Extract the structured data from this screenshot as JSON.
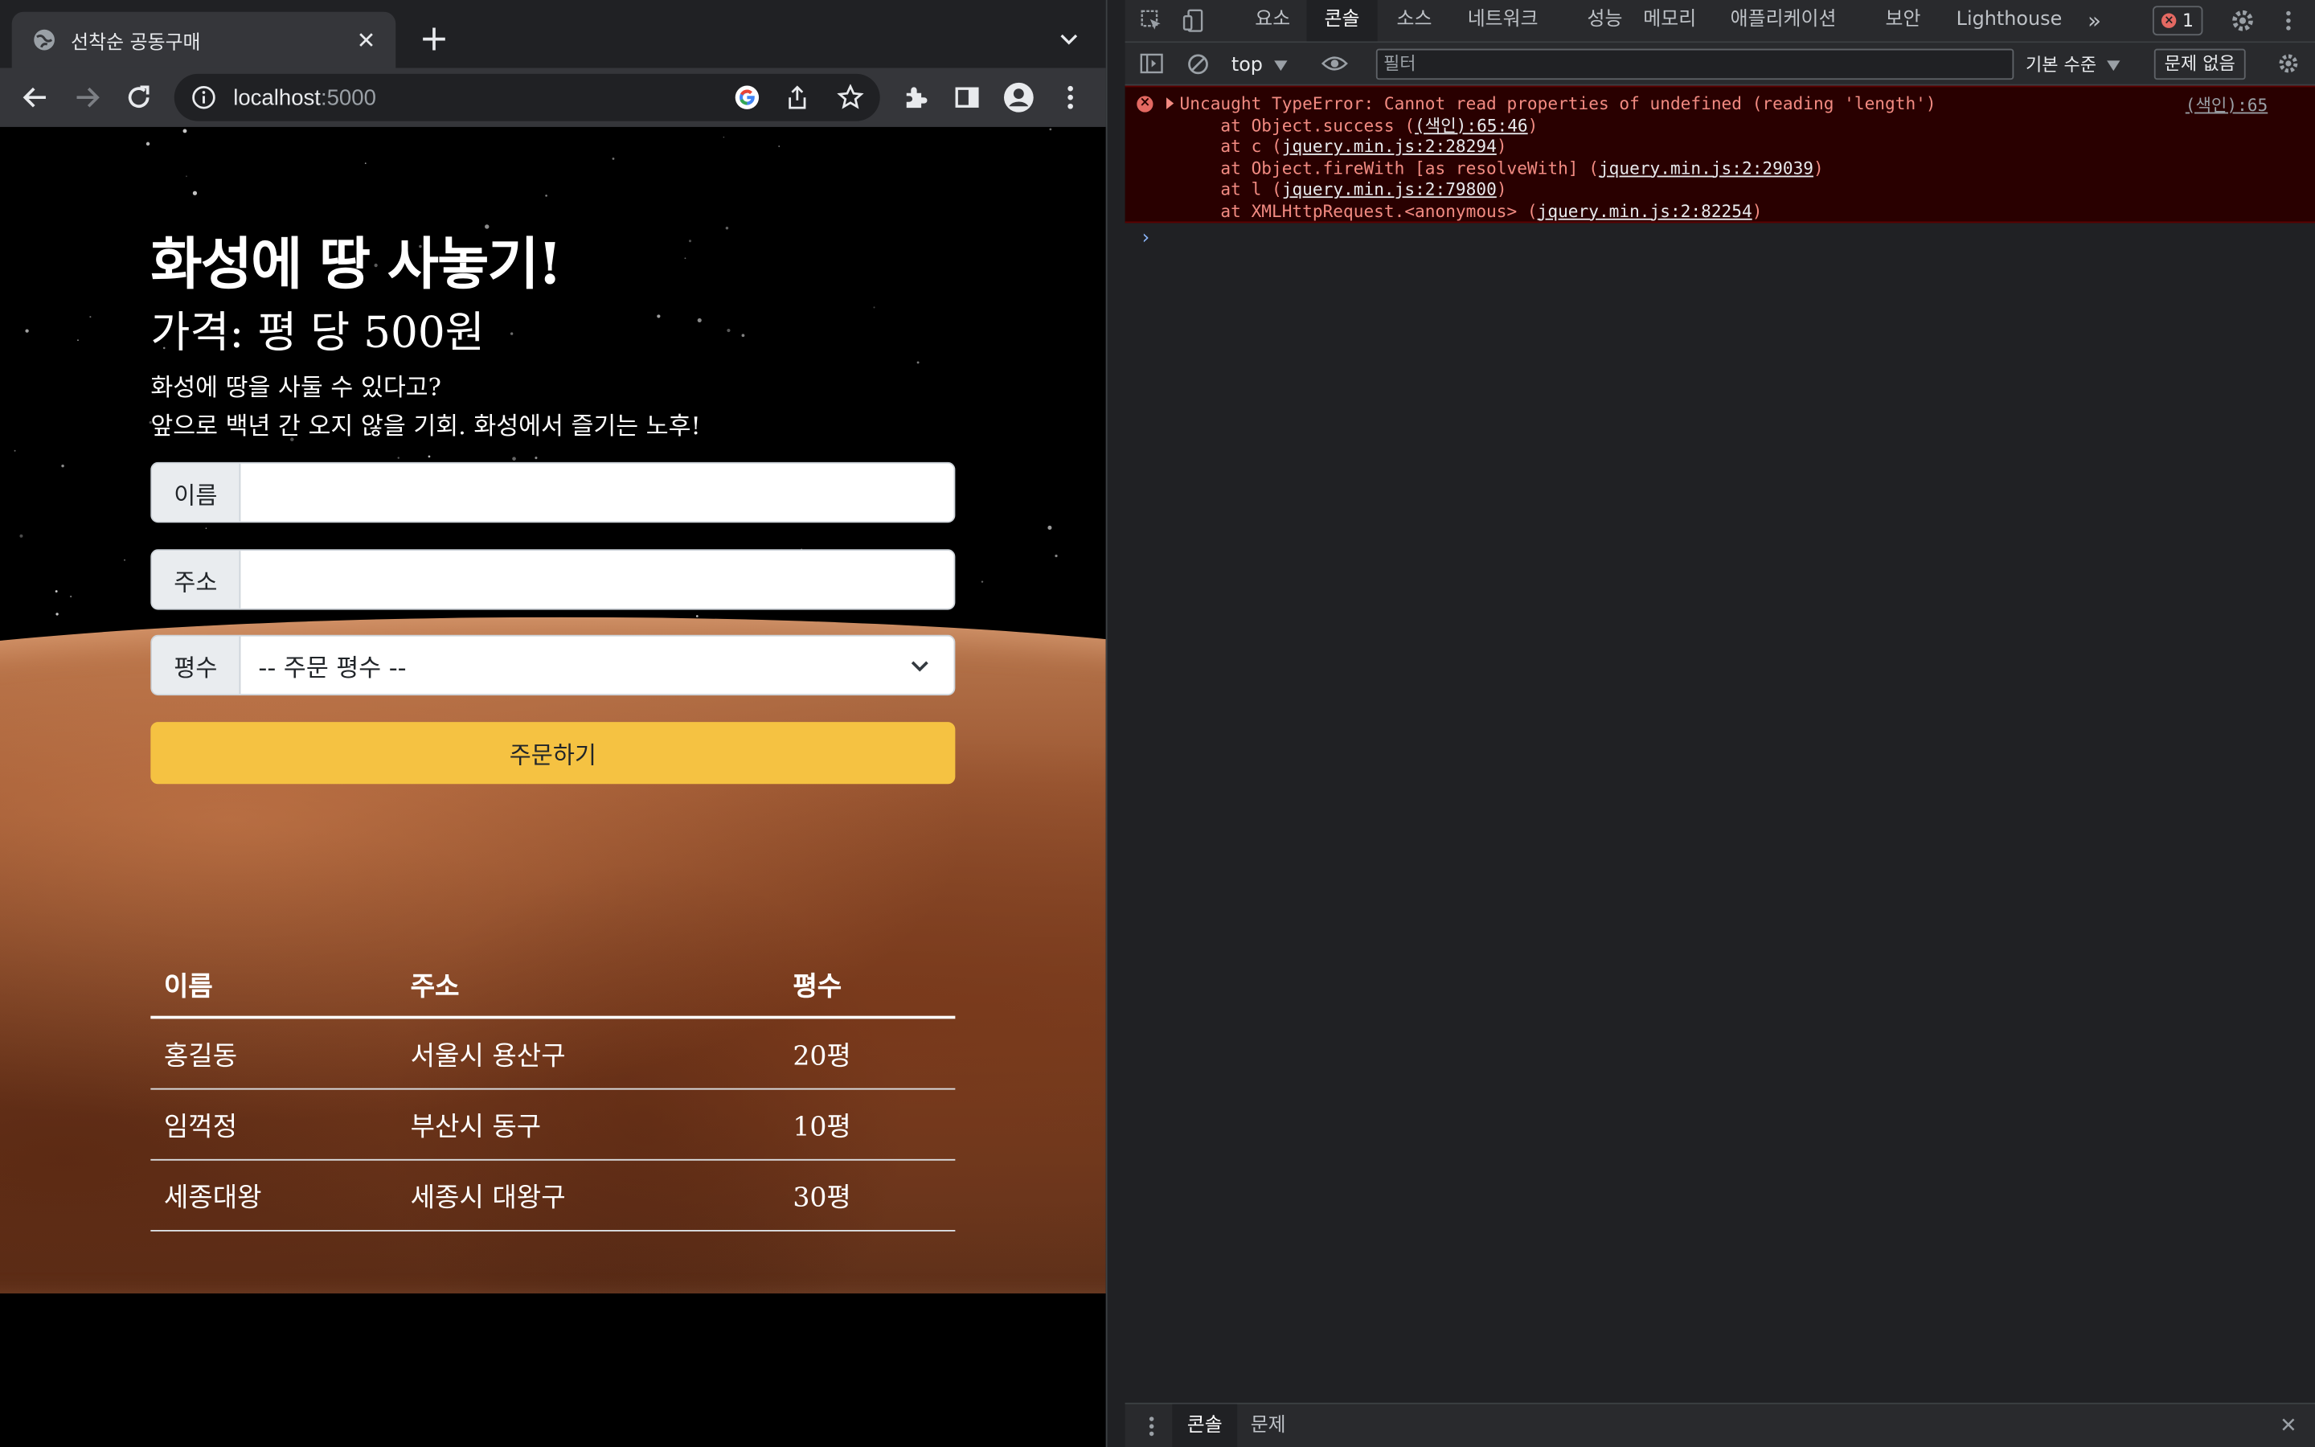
{
  "browser": {
    "tab_title": "선착순 공동구매",
    "new_tab": "+",
    "url_host": "localhost",
    "url_port": ":5000"
  },
  "page": {
    "title": "화성에 땅 사놓기!",
    "price": "가격: 평 당 500원",
    "desc_line1": "화성에 땅을 사둘 수 있다고?",
    "desc_line2": "앞으로 백년 간 오지 않을 기회. 화성에서 즐기는 노후!",
    "form": {
      "name_label": "이름",
      "name_value": "",
      "address_label": "주소",
      "address_value": "",
      "size_label": "평수",
      "size_selected": "-- 주문 평수 --",
      "submit_label": "주문하기"
    },
    "table": {
      "headers": [
        "이름",
        "주소",
        "평수"
      ],
      "rows": [
        [
          "홍길동",
          "서울시 용산구",
          "20평"
        ],
        [
          "임꺽정",
          "부산시 동구",
          "10평"
        ],
        [
          "세종대왕",
          "세종시 대왕구",
          "30평"
        ]
      ]
    }
  },
  "devtools": {
    "tabs": [
      "요소",
      "콘솔",
      "소스",
      "네트워크",
      "성능",
      "메모리",
      "애플리케이션",
      "보안",
      "Lighthouse"
    ],
    "active_tab": "콘솔",
    "more": "»",
    "error_count": "1",
    "context": "top",
    "filter_placeholder": "필터",
    "levels": "기본 수준",
    "issues": "문제 없음",
    "error": {
      "message": "Uncaught TypeError: Cannot read properties of undefined (reading 'length')",
      "source": "(색인):65",
      "stack": [
        {
          "prefix": "    at Object.success (",
          "link": "(색인):65:46",
          "suffix": ")"
        },
        {
          "prefix": "    at c (",
          "link": "jquery.min.js:2:28294",
          "suffix": ")"
        },
        {
          "prefix": "    at Object.fireWith [as resolveWith] (",
          "link": "jquery.min.js:2:29039",
          "suffix": ")"
        },
        {
          "prefix": "    at l (",
          "link": "jquery.min.js:2:79800",
          "suffix": ")"
        },
        {
          "prefix": "    at XMLHttpRequest.<anonymous> (",
          "link": "jquery.min.js:2:82254",
          "suffix": ")"
        }
      ]
    },
    "prompt": "›",
    "drawer_tabs": [
      "콘솔",
      "문제"
    ],
    "drawer_close": "✕"
  },
  "colors": {
    "button": "#f5c242",
    "error_bg": "#290000",
    "error_text": "#f28b82"
  }
}
